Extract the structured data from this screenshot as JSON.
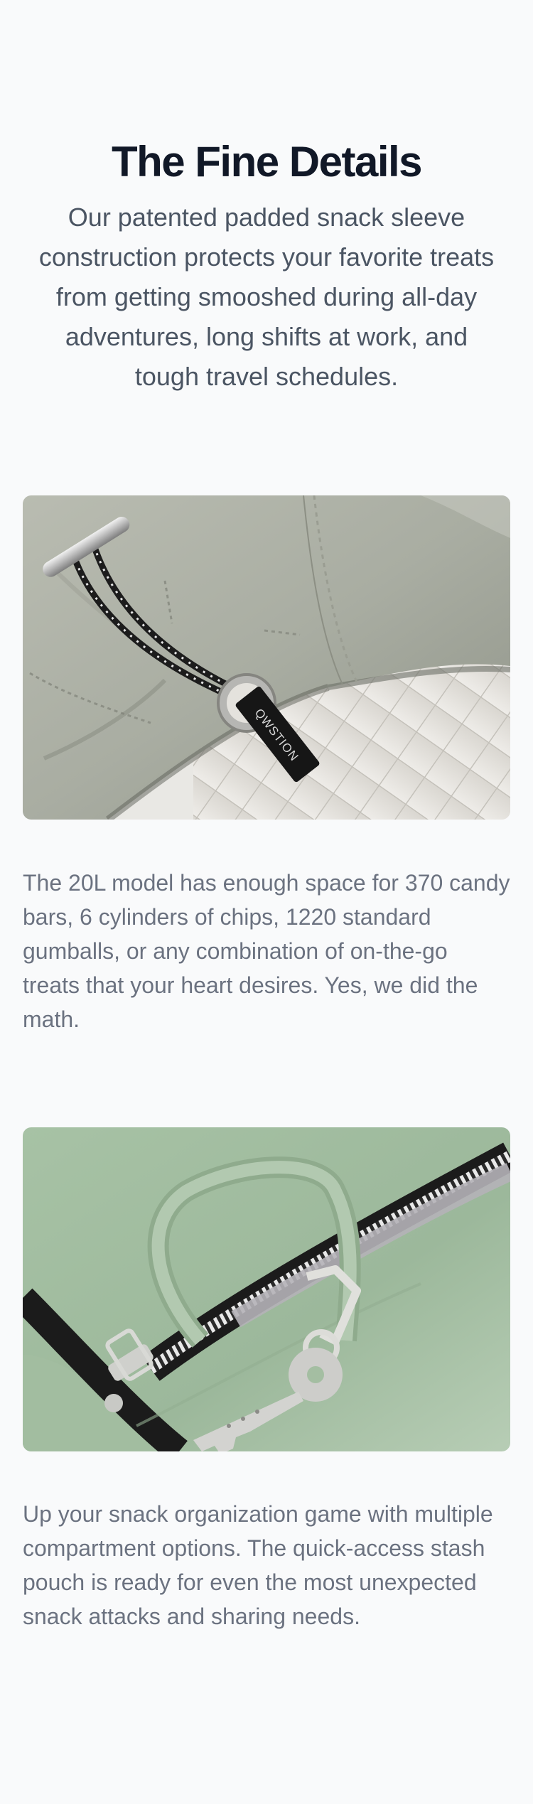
{
  "section": {
    "title": "The Fine Details",
    "intro": "Our patented padded snack sleeve construction protects your favorite treats from getting smooshed during all-day adventures, long shifts at work, and tough travel schedules."
  },
  "features": [
    {
      "image_label": "QWSTION",
      "text": "The 20L model has enough space for 370 candy bars, 6 cylinders of chips, 1220 standard gumballs, or any combination of on-the-go treats that your heart desires. Yes, we did the math."
    },
    {
      "text": "Up your snack organization game with multiple compartment options. The quick-access stash pouch is ready for even the most unexpected snack attacks and sharing needs."
    }
  ]
}
